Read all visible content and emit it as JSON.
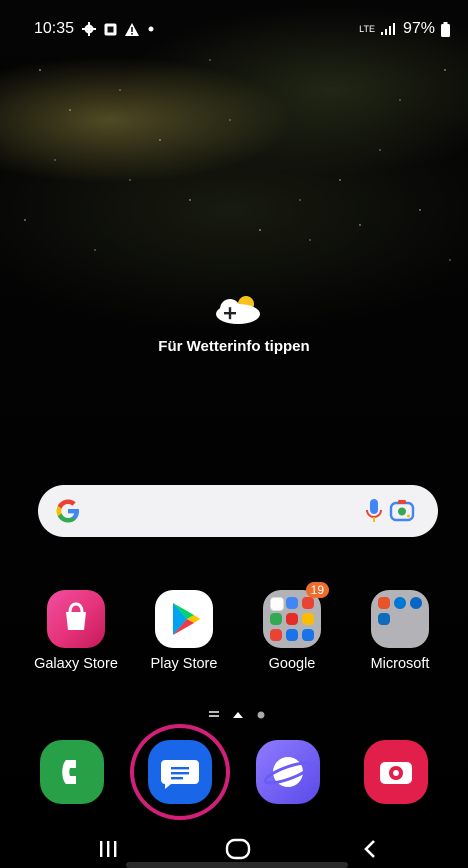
{
  "status": {
    "time": "10:35",
    "network": "LTE",
    "battery": "97%"
  },
  "weather": {
    "label": "Für Wetterinfo tippen"
  },
  "search": {
    "provider": "Google"
  },
  "apps": [
    {
      "label": "Galaxy Store"
    },
    {
      "label": "Play Store"
    },
    {
      "label": "Google",
      "badge": "19"
    },
    {
      "label": "Microsoft"
    }
  ],
  "dock": [
    {
      "name": "phone"
    },
    {
      "name": "messages"
    },
    {
      "name": "samsung-internet"
    },
    {
      "name": "camera"
    }
  ],
  "colors": {
    "highlight_ring": "#d2207a",
    "galaxy_store": "#e5327a",
    "phone": "#27a048",
    "messages": "#1a66e8",
    "internet": "#6a5cf5",
    "camera": "#e21f4a"
  }
}
